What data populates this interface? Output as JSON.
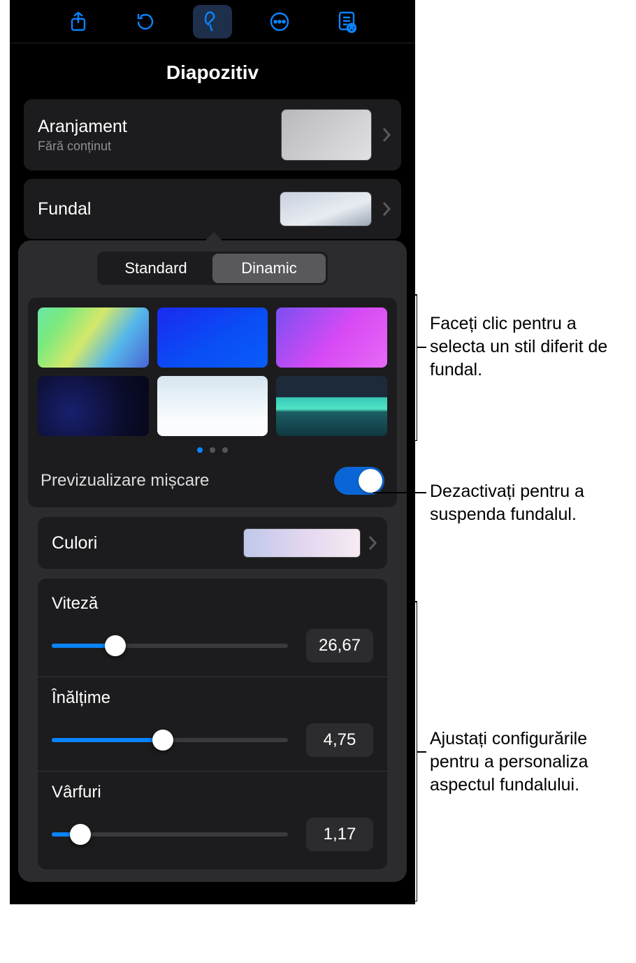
{
  "title": "Diapozitiv",
  "arrangement": {
    "label": "Aranjament",
    "sub": "Fără conținut"
  },
  "background_row": {
    "label": "Fundal"
  },
  "segmented": {
    "standard": "Standard",
    "dynamic": "Dinamic"
  },
  "preview_toggle": {
    "label": "Previzualizare mișcare",
    "on": true
  },
  "colors_row": {
    "label": "Culori"
  },
  "sliders": {
    "speed": {
      "label": "Viteză",
      "value": "26,67",
      "pct": 27
    },
    "height": {
      "label": "Înălțime",
      "value": "4,75",
      "pct": 47
    },
    "peaks": {
      "label": "Vârfuri",
      "value": "1,17",
      "pct": 12
    }
  },
  "callouts": {
    "styles": "Faceți clic pentru a selecta un stil diferit de fundal.",
    "toggle": "Dezactivați pentru a suspenda fundalul.",
    "sliders": "Ajustați configurările pentru a personaliza aspectul fundalului."
  }
}
